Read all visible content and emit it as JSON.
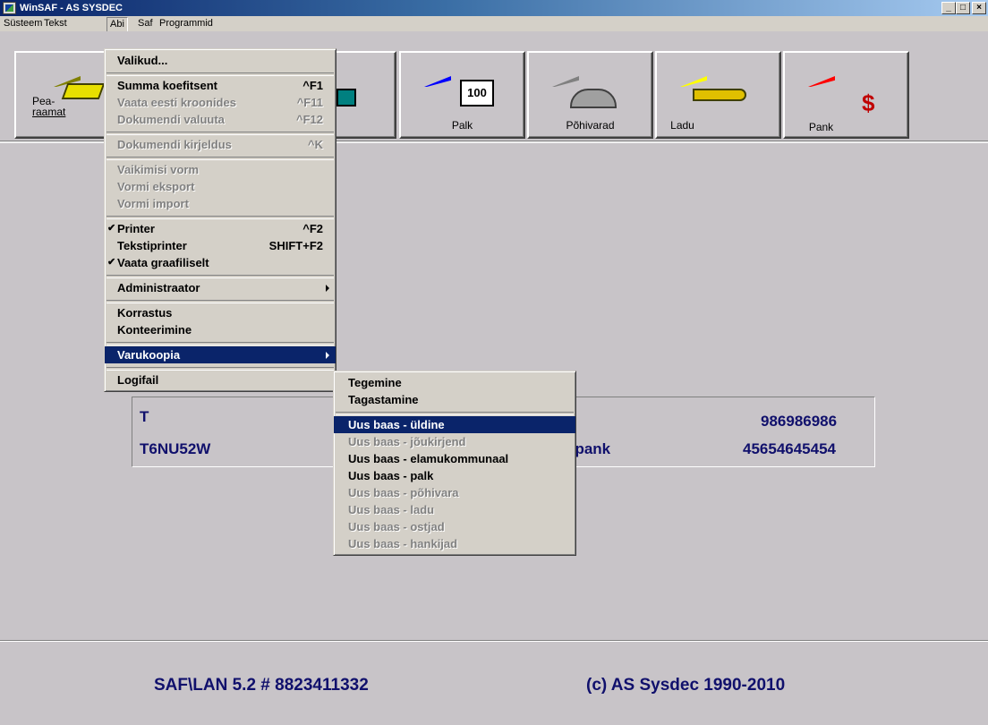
{
  "window": {
    "title": "WinSAF - AS SYSDEC",
    "min": "_",
    "max": "□",
    "close": "×"
  },
  "menubar": [
    "Süsteem",
    "Tekst",
    "Abi",
    "Saf",
    "Programmid"
  ],
  "toolbar": [
    {
      "label_line1": "Pea-",
      "label_line2": "raamat",
      "icon": "book-icon",
      "flag_color": "#808000"
    },
    {
      "label": "",
      "icon": "truck-icon"
    },
    {
      "label": "Palk",
      "icon": "calendar-icon",
      "flag_color": "#0000ff"
    },
    {
      "label": "Põhivarad",
      "icon": "hangar-icon",
      "flag_color": "#808080"
    },
    {
      "label": "Ladu",
      "icon": "key-icon",
      "flag_color": "#ffff00"
    },
    {
      "label": "Pank",
      "icon": "dollar-icon",
      "flag_color": "#ff0000"
    }
  ],
  "abi_menu": {
    "valikud": "Valikud...",
    "summa_koefitsent": "Summa koefitsent",
    "summa_sc": "^F1",
    "vaata_eesti": "Vaata eesti kroonides",
    "vaata_sc": "^F11",
    "dok_valuuta": "Dokumendi valuuta",
    "dok_valuuta_sc": "^F12",
    "dok_kirjeldus": "Dokumendi kirjeldus",
    "dok_kirjeldus_sc": "^K",
    "vaikimisi_vorm": "Vaikimisi vorm",
    "vormi_eksport": "Vormi eksport",
    "vormi_import": "Vormi import",
    "printer": "Printer",
    "printer_sc": "^F2",
    "tekstiprinter": "Tekstiprinter",
    "tekstiprinter_sc": "SHIFT+F2",
    "vaata_graafiliselt": "Vaata graafiliselt",
    "administraator": "Administraator",
    "korrastus": "Korrastus",
    "konteerimine": "Konteerimine",
    "varukoopia": "Varukoopia",
    "logifail": "Logifail"
  },
  "varukoopia_menu": {
    "tegemine": "Tegemine",
    "tagastamine": "Tagastamine",
    "uus_uldine": "Uus baas - üldine",
    "uus_joukirjend": "Uus baas - jõukirjend",
    "uus_elamukommunaal": "Uus baas - elamukommunaal",
    "uus_palk": "Uus baas - palk",
    "uus_pohivara": "Uus baas - põhivara",
    "uus_ladu": "Uus baas - ladu",
    "uus_ostjad": "Uus baas - ostjad",
    "uus_hankijad": "Uus baas - hankijad"
  },
  "panel": {
    "row1_left": "T",
    "row1_right": "986986986",
    "row2_left": "T6NU52W",
    "row2_mid": "spank",
    "row2_right": "45654645454"
  },
  "footer": {
    "version": "SAF\\LAN 5.2   #  8823411332",
    "copyright": "(c)  AS  Sysdec  1990-2010"
  }
}
